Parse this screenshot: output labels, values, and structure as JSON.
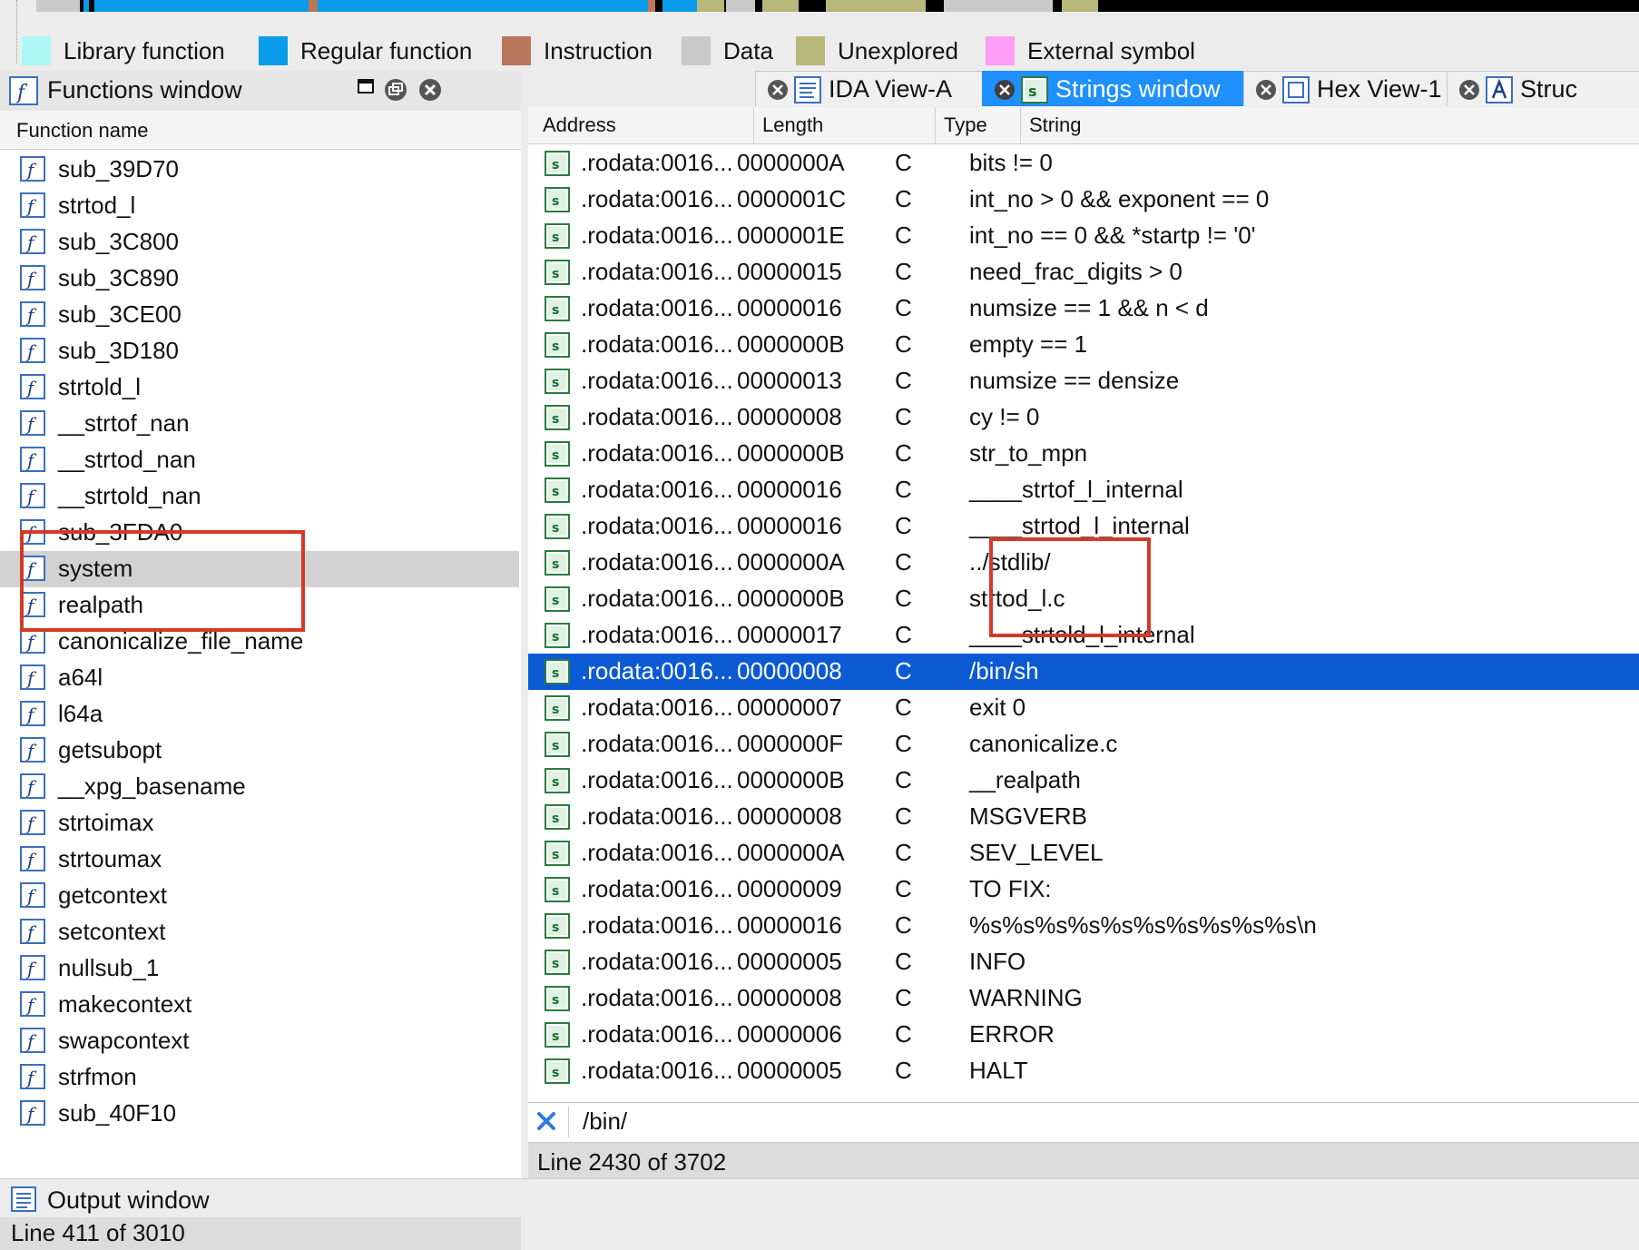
{
  "colors": {
    "library": "#aef7f7",
    "regular": "#0a9cea",
    "instruction": "#b8775a",
    "data": "#c9c9c9",
    "unexplored": "#b9b779",
    "external": "#ff9cf5",
    "selection": "#0b5ad4",
    "annotation": "#d33a26"
  },
  "legend": [
    {
      "label": "Library function",
      "color": "#aef7f7"
    },
    {
      "label": "Regular function",
      "color": "#0a9cea"
    },
    {
      "label": "Instruction",
      "color": "#b8775a"
    },
    {
      "label": "Data",
      "color": "#c9c9c9"
    },
    {
      "label": "Unexplored",
      "color": "#b9b779"
    },
    {
      "label": "External symbol",
      "color": "#ff9cf5"
    }
  ],
  "functions_window": {
    "title": "Functions window",
    "column": "Function name",
    "status": "Line 411 of 3010",
    "items": [
      "sub_39D70",
      "strtod_l",
      "sub_3C800",
      "sub_3C890",
      "sub_3CE00",
      "sub_3D180",
      "strtold_l",
      "__strtof_nan",
      "__strtod_nan",
      "__strtold_nan",
      "sub_3FDA0",
      "system",
      "realpath",
      "canonicalize_file_name",
      "a64l",
      "l64a",
      "getsubopt",
      "__xpg_basename",
      "strtoimax",
      "strtoumax",
      "getcontext",
      "setcontext",
      "nullsub_1",
      "makecontext",
      "swapcontext",
      "strfmon",
      "sub_40F10"
    ],
    "selected_index": 11
  },
  "tabs": [
    {
      "label": "IDA View-A",
      "icon": "ida-view-icon",
      "active": false
    },
    {
      "label": "Strings window",
      "icon": "strings-icon",
      "active": true
    },
    {
      "label": "Hex View-1",
      "icon": "hex-view-icon",
      "active": false
    },
    {
      "label": "Struc",
      "icon": "structures-icon",
      "active": false
    }
  ],
  "strings_window": {
    "columns": [
      "Address",
      "Length",
      "Type",
      "String"
    ],
    "status": "Line 2430 of 3702",
    "search_value": "/bin/",
    "selected_index": 14,
    "rows": [
      {
        "address": ".rodata:0016...",
        "length": "0000000A",
        "type": "C",
        "string": "bits != 0"
      },
      {
        "address": ".rodata:0016...",
        "length": "0000001C",
        "type": "C",
        "string": "int_no > 0 && exponent == 0"
      },
      {
        "address": ".rodata:0016...",
        "length": "0000001E",
        "type": "C",
        "string": "int_no == 0 && *startp != '0'"
      },
      {
        "address": ".rodata:0016...",
        "length": "00000015",
        "type": "C",
        "string": "need_frac_digits > 0"
      },
      {
        "address": ".rodata:0016...",
        "length": "00000016",
        "type": "C",
        "string": "numsize == 1 && n < d"
      },
      {
        "address": ".rodata:0016...",
        "length": "0000000B",
        "type": "C",
        "string": "empty == 1"
      },
      {
        "address": ".rodata:0016...",
        "length": "00000013",
        "type": "C",
        "string": "numsize == densize"
      },
      {
        "address": ".rodata:0016...",
        "length": "00000008",
        "type": "C",
        "string": "cy != 0"
      },
      {
        "address": ".rodata:0016...",
        "length": "0000000B",
        "type": "C",
        "string": "str_to_mpn"
      },
      {
        "address": ".rodata:0016...",
        "length": "00000016",
        "type": "C",
        "string": "____strtof_l_internal"
      },
      {
        "address": ".rodata:0016...",
        "length": "00000016",
        "type": "C",
        "string": "____strtod_l_internal"
      },
      {
        "address": ".rodata:0016...",
        "length": "0000000A",
        "type": "C",
        "string": "../stdlib/"
      },
      {
        "address": ".rodata:0016...",
        "length": "0000000B",
        "type": "C",
        "string": "strtod_l.c"
      },
      {
        "address": ".rodata:0016...",
        "length": "00000017",
        "type": "C",
        "string": "____strtold_l_internal"
      },
      {
        "address": ".rodata:0016...",
        "length": "00000008",
        "type": "C",
        "string": "/bin/sh"
      },
      {
        "address": ".rodata:0016...",
        "length": "00000007",
        "type": "C",
        "string": "exit 0"
      },
      {
        "address": ".rodata:0016...",
        "length": "0000000F",
        "type": "C",
        "string": "canonicalize.c"
      },
      {
        "address": ".rodata:0016...",
        "length": "0000000B",
        "type": "C",
        "string": "__realpath"
      },
      {
        "address": ".rodata:0016...",
        "length": "00000008",
        "type": "C",
        "string": "MSGVERB"
      },
      {
        "address": ".rodata:0016...",
        "length": "0000000A",
        "type": "C",
        "string": "SEV_LEVEL"
      },
      {
        "address": ".rodata:0016...",
        "length": "00000009",
        "type": "C",
        "string": "TO FIX:"
      },
      {
        "address": ".rodata:0016...",
        "length": "00000016",
        "type": "C",
        "string": "%s%s%s%s%s%s%s%s%s%s\\n"
      },
      {
        "address": ".rodata:0016...",
        "length": "00000005",
        "type": "C",
        "string": "INFO"
      },
      {
        "address": ".rodata:0016...",
        "length": "00000008",
        "type": "C",
        "string": "WARNING"
      },
      {
        "address": ".rodata:0016...",
        "length": "00000006",
        "type": "C",
        "string": "ERROR"
      },
      {
        "address": ".rodata:0016...",
        "length": "00000005",
        "type": "C",
        "string": "HALT"
      }
    ]
  },
  "output_window": {
    "title": "Output window"
  }
}
